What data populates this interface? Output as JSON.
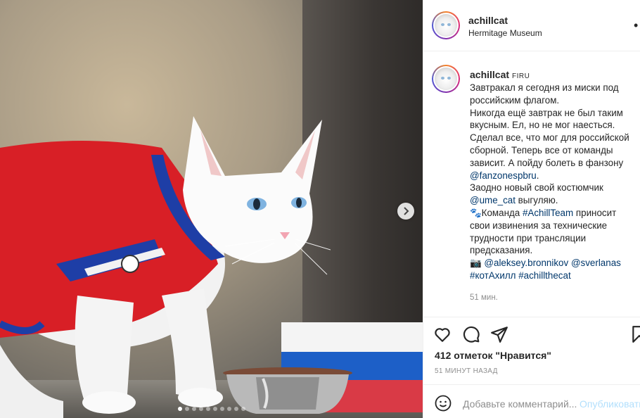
{
  "post": {
    "username": "achillcat",
    "location": "Hermitage Museum",
    "caption_tag": "FIRU",
    "caption_lines": [
      {
        "text": "Завтракал я сегодня из миски под"
      },
      {
        "text": "российским флагом."
      },
      {
        "text": "Никогда ещё завтрак не был таким"
      },
      {
        "text": "вкусным. Ел, но не мог наесться."
      },
      {
        "text": "Сделал все, что мог для российской"
      },
      {
        "text": "сборной. Теперь все от команды"
      },
      {
        "text": "зависит. А пойду болеть в фанзону"
      },
      {
        "link": "@fanzonespbru",
        "after": "."
      },
      {
        "text": "Заодно новый свой костюмчик"
      },
      {
        "link": "@ume_cat",
        "after": " выгуляю."
      },
      {
        "before": "🐾Команда ",
        "link": "#AchillTeam",
        "after": " приносит"
      },
      {
        "text": "свои извинения за технические"
      },
      {
        "text": "трудности при трансляции"
      },
      {
        "text": "предсказания."
      },
      {
        "before": "📷 ",
        "link": "@aleksey.bronnikov",
        "mid": " ",
        "link2": "@sverlanas"
      },
      {
        "link": "#котАхилл",
        "mid": " ",
        "link2": "#achillthecat"
      }
    ],
    "caption_time": "51 мин.",
    "likes": "412 отметок \"Нравится\"",
    "post_age": "51 МИНУТ НАЗАД",
    "comment_placeholder": "Добавьте комментарий...",
    "publish_label": "Опубликовать",
    "more_label": "•",
    "carousel": {
      "count": 10,
      "active": 0
    }
  },
  "icons": {
    "like": "heart-icon",
    "comment": "comment-icon",
    "share": "paper-plane-icon",
    "save": "bookmark-icon",
    "emoji": "smiley-icon",
    "next": "chevron-right-icon"
  },
  "colors": {
    "link": "#00376b",
    "muted": "#8e8e8e",
    "publish_disabled": "#b2dffc",
    "border": "#efefef"
  }
}
